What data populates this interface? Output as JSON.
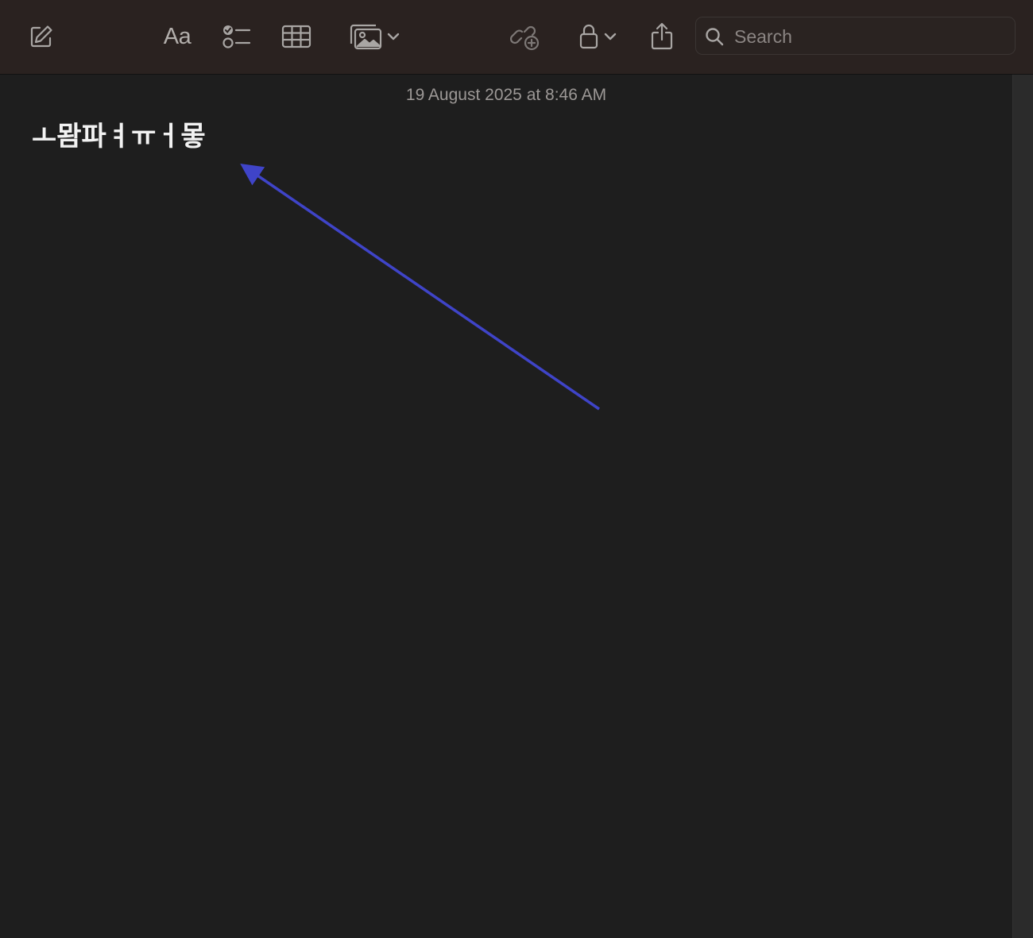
{
  "toolbar": {
    "buttons": [
      {
        "name": "compose-icon"
      },
      {
        "name": "format-text",
        "label": "Aa"
      },
      {
        "name": "checklist-icon"
      },
      {
        "name": "table-icon"
      },
      {
        "name": "media-icon"
      },
      {
        "name": "collaborate-icon"
      },
      {
        "name": "lock-icon"
      },
      {
        "name": "share-icon"
      }
    ],
    "format_label": "Aa",
    "search": {
      "placeholder": "Search",
      "value": ""
    }
  },
  "note": {
    "timestamp": "19 August 2025 at 8:46 AM",
    "title": "ㅗ뫔파ㅕㅠㅓ뫃"
  },
  "annotation": {
    "arrow_color": "#3f44c8"
  },
  "colors": {
    "background": "#1e1e1e",
    "toolbar": "#2a2220",
    "icon": "#a9a6a4",
    "text": "#f2f2f2",
    "timestamp": "#9c9896"
  }
}
